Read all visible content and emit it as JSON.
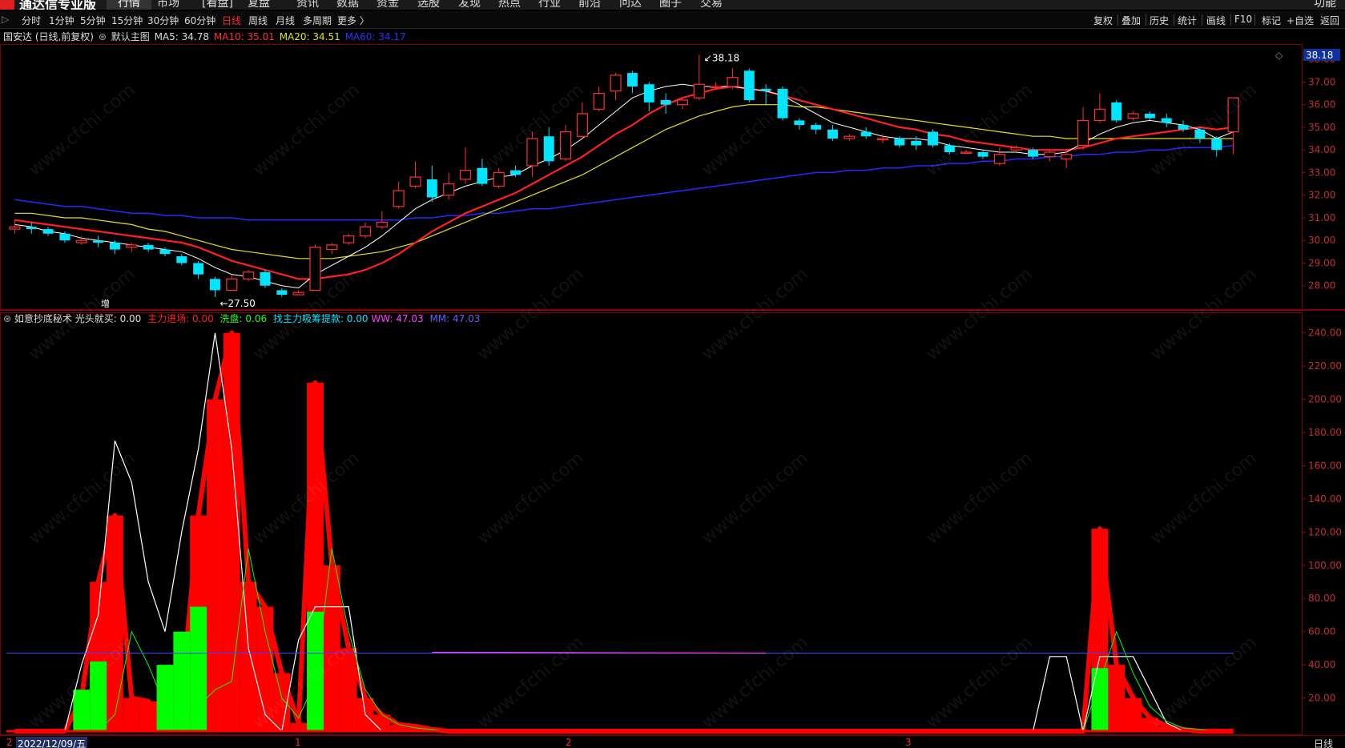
{
  "app": {
    "name": "通达信专业版"
  },
  "menu": [
    "行情",
    "市场",
    "[看盘]",
    "复盘",
    "资讯",
    "数据",
    "资金",
    "选股",
    "发现",
    "热点",
    "行业",
    "前沿",
    "问达",
    "圈子",
    "交易"
  ],
  "menu_right": "功能",
  "periods": [
    "分时",
    "1分钟",
    "5分钟",
    "15分钟",
    "30分钟",
    "60分钟",
    "日线",
    "周线",
    "月线",
    "多周期",
    "更多 〉"
  ],
  "active_period": "日线",
  "tools": [
    "复权",
    "叠加",
    "历史",
    "统计",
    "画线",
    "F10",
    "标记",
    "+自选",
    "返回"
  ],
  "main_info": {
    "stock": "国安达 (日线,前复权)",
    "template": "默认主图",
    "ma5": "MA5: 34.78",
    "ma10": "MA10: 35.01",
    "ma20": "MA20: 34.51",
    "ma60": "MA60: 34.17"
  },
  "price_axis": {
    "labels": [
      "38.00",
      "37.00",
      "36.00",
      "35.00",
      "34.00",
      "33.00",
      "32.00",
      "31.00",
      "30.00",
      "29.00",
      "28.00"
    ],
    "current": "38.18"
  },
  "annotations": {
    "high": "38.18",
    "low": "27.50",
    "marker": "增"
  },
  "ind_info": {
    "name": "如意抄底秘术",
    "gt": "光头就买: 0.00",
    "zl": "主力进场: 0.00",
    "xp": "洗盘: 0.06",
    "zhao": "找主力吸筹提款: 0.00",
    "ww": "WW: 47.03",
    "mm": "MM: 47.03"
  },
  "ind_axis": {
    "labels": [
      "240.00",
      "220.00",
      "200.00",
      "180.00",
      "160.00",
      "140.00",
      "120.00",
      "100.00",
      "80.00",
      "60.00",
      "40.00",
      "20.00"
    ]
  },
  "dates": {
    "first": "2022/12/09/五",
    "m1": "1",
    "m2": "2",
    "m3": "3",
    "period_label": "日线"
  },
  "watermark": "www.cfchi.com",
  "colors": {
    "up": "#ff3030",
    "down": "#00e5ff",
    "ma5": "#ffffff",
    "ma10": "#ff2020",
    "ma20": "#e0e020",
    "ma60": "#2828ff",
    "ind_red": "#ff0000",
    "ind_green": "#00ff00",
    "ww": "#ff40ff",
    "mm": "#4040ff"
  },
  "chart_data": {
    "type": "candlestick",
    "price_range": [
      27.0,
      38.5
    ],
    "candles": [
      [
        30.5,
        30.6,
        30.9,
        30.3
      ],
      [
        30.6,
        30.5,
        30.8,
        30.3
      ],
      [
        30.5,
        30.3,
        30.6,
        30.2
      ],
      [
        30.3,
        30.0,
        30.4,
        29.9
      ],
      [
        29.9,
        30.0,
        30.2,
        29.8
      ],
      [
        30.0,
        29.9,
        30.2,
        29.7
      ],
      [
        29.9,
        29.6,
        30.0,
        29.4
      ],
      [
        29.7,
        29.8,
        29.9,
        29.5
      ],
      [
        29.8,
        29.6,
        29.9,
        29.5
      ],
      [
        29.6,
        29.4,
        29.7,
        29.3
      ],
      [
        29.3,
        29.0,
        29.4,
        28.9
      ],
      [
        29.0,
        28.5,
        29.1,
        28.3
      ],
      [
        28.3,
        27.8,
        28.4,
        27.5
      ],
      [
        27.8,
        28.3,
        28.5,
        27.8
      ],
      [
        28.3,
        28.6,
        28.7,
        28.2
      ],
      [
        28.6,
        28.0,
        28.7,
        27.9
      ],
      [
        27.8,
        27.6,
        27.9,
        27.5
      ],
      [
        27.6,
        27.7,
        27.8,
        27.6
      ],
      [
        27.8,
        29.7,
        29.8,
        27.8
      ],
      [
        29.6,
        29.8,
        29.9,
        29.4
      ],
      [
        29.9,
        30.2,
        30.3,
        29.8
      ],
      [
        30.2,
        30.6,
        30.8,
        30.1
      ],
      [
        30.6,
        30.8,
        31.3,
        30.5
      ],
      [
        31.5,
        32.2,
        32.6,
        31.4
      ],
      [
        32.4,
        32.8,
        33.5,
        32.3
      ],
      [
        32.7,
        31.9,
        33.3,
        31.7
      ],
      [
        32.0,
        32.5,
        33.0,
        31.8
      ],
      [
        32.7,
        33.1,
        34.1,
        32.5
      ],
      [
        33.2,
        32.5,
        33.6,
        32.4
      ],
      [
        32.4,
        33.0,
        33.2,
        32.3
      ],
      [
        33.1,
        32.9,
        33.3,
        32.8
      ],
      [
        33.3,
        34.5,
        34.8,
        32.8
      ],
      [
        34.6,
        33.5,
        35.0,
        33.3
      ],
      [
        33.6,
        34.8,
        35.1,
        33.5
      ],
      [
        34.6,
        35.6,
        36.1,
        34.5
      ],
      [
        35.8,
        36.5,
        36.8,
        35.7
      ],
      [
        36.6,
        37.3,
        37.4,
        36.2
      ],
      [
        37.4,
        36.8,
        37.5,
        36.5
      ],
      [
        36.9,
        36.1,
        37.0,
        35.7
      ],
      [
        36.2,
        36.0,
        36.5,
        35.6
      ],
      [
        36.0,
        36.2,
        36.3,
        35.8
      ],
      [
        36.3,
        36.9,
        38.2,
        36.2
      ],
      [
        36.8,
        36.8,
        37.0,
        36.7
      ],
      [
        36.8,
        37.2,
        37.6,
        36.7
      ],
      [
        37.5,
        36.2,
        37.6,
        36.1
      ],
      [
        36.7,
        36.6,
        36.9,
        36.0
      ],
      [
        36.7,
        35.4,
        36.8,
        35.3
      ],
      [
        35.3,
        35.1,
        35.4,
        34.9
      ],
      [
        35.1,
        34.9,
        35.2,
        34.7
      ],
      [
        34.9,
        34.5,
        35.1,
        34.4
      ],
      [
        34.5,
        34.6,
        34.7,
        34.4
      ],
      [
        34.8,
        34.6,
        35.0,
        34.5
      ],
      [
        34.5,
        34.5,
        34.7,
        34.3
      ],
      [
        34.5,
        34.2,
        34.6,
        34.1
      ],
      [
        34.4,
        34.2,
        34.6,
        34.0
      ],
      [
        34.8,
        34.2,
        34.9,
        34.1
      ],
      [
        34.2,
        33.9,
        34.3,
        33.8
      ],
      [
        33.9,
        33.9,
        34.0,
        33.8
      ],
      [
        33.9,
        33.7,
        34.0,
        33.6
      ],
      [
        33.4,
        33.8,
        34.1,
        33.3
      ],
      [
        34.0,
        34.1,
        34.2,
        33.9
      ],
      [
        34.0,
        33.7,
        34.1,
        33.6
      ],
      [
        33.7,
        33.9,
        34.0,
        33.5
      ],
      [
        33.6,
        33.8,
        34.0,
        33.2
      ],
      [
        34.2,
        35.3,
        35.9,
        34.0
      ],
      [
        35.3,
        35.8,
        36.5,
        35.2
      ],
      [
        36.1,
        35.3,
        36.2,
        35.2
      ],
      [
        35.4,
        35.6,
        35.7,
        35.3
      ],
      [
        35.6,
        35.4,
        35.7,
        35.3
      ],
      [
        35.4,
        35.2,
        35.6,
        35.0
      ],
      [
        35.1,
        34.9,
        35.3,
        34.8
      ],
      [
        34.9,
        34.5,
        35.0,
        34.3
      ],
      [
        34.5,
        34.0,
        34.6,
        33.7
      ],
      [
        34.8,
        36.3,
        36.3,
        33.8
      ]
    ],
    "ma5": [
      30.7,
      30.6,
      30.4,
      30.3,
      30.1,
      30.0,
      29.9,
      29.8,
      29.7,
      29.6,
      29.5,
      29.2,
      28.8,
      28.5,
      28.4,
      28.2,
      28.0,
      27.9,
      28.5,
      28.9,
      29.3,
      29.7,
      30.2,
      30.8,
      31.4,
      31.8,
      32.1,
      32.4,
      32.6,
      32.8,
      32.9,
      33.3,
      33.6,
      34.0,
      34.5,
      35.1,
      35.7,
      36.3,
      36.6,
      36.8,
      36.9,
      36.8,
      36.8,
      36.8,
      36.7,
      36.6,
      36.4,
      36.0,
      35.6,
      35.2,
      35.0,
      34.8,
      34.6,
      34.5,
      34.5,
      34.4,
      34.2,
      34.1,
      34.0,
      33.9,
      33.9,
      33.8,
      33.8,
      33.9,
      34.3,
      34.7,
      35.0,
      35.2,
      35.3,
      35.2,
      35.1,
      34.9,
      34.5,
      34.8
    ],
    "ma10": [
      30.9,
      30.8,
      30.7,
      30.6,
      30.5,
      30.4,
      30.3,
      30.2,
      30.1,
      30.0,
      29.9,
      29.7,
      29.4,
      29.1,
      28.9,
      28.7,
      28.5,
      28.3,
      28.3,
      28.4,
      28.5,
      28.7,
      29.0,
      29.4,
      29.9,
      30.4,
      30.8,
      31.2,
      31.5,
      31.8,
      32.1,
      32.5,
      32.9,
      33.3,
      33.7,
      34.2,
      34.7,
      35.1,
      35.6,
      36.0,
      36.3,
      36.5,
      36.7,
      36.8,
      36.7,
      36.6,
      36.4,
      36.2,
      36.0,
      35.8,
      35.6,
      35.4,
      35.2,
      35.0,
      34.9,
      34.7,
      34.6,
      34.4,
      34.3,
      34.2,
      34.1,
      34.0,
      34.0,
      34.0,
      34.1,
      34.3,
      34.5,
      34.6,
      34.7,
      34.8,
      34.9,
      35.0,
      34.9,
      35.0
    ],
    "ma20": [
      31.2,
      31.2,
      31.1,
      31.0,
      31.0,
      30.9,
      30.8,
      30.7,
      30.5,
      30.4,
      30.2,
      30.0,
      29.8,
      29.6,
      29.5,
      29.4,
      29.3,
      29.2,
      29.2,
      29.2,
      29.3,
      29.4,
      29.5,
      29.7,
      29.9,
      30.2,
      30.5,
      30.8,
      31.1,
      31.4,
      31.7,
      32.0,
      32.3,
      32.6,
      32.9,
      33.3,
      33.7,
      34.1,
      34.5,
      34.9,
      35.2,
      35.5,
      35.7,
      35.9,
      36.0,
      36.0,
      36.0,
      35.9,
      35.9,
      35.8,
      35.7,
      35.6,
      35.5,
      35.4,
      35.3,
      35.2,
      35.1,
      35.0,
      34.9,
      34.8,
      34.7,
      34.6,
      34.6,
      34.5,
      34.5,
      34.5,
      34.5,
      34.5,
      34.5,
      34.5,
      34.5,
      34.5,
      34.5,
      34.5
    ],
    "ma60": [
      31.8,
      31.7,
      31.6,
      31.5,
      31.5,
      31.4,
      31.3,
      31.2,
      31.2,
      31.1,
      31.1,
      31.0,
      31.0,
      31.0,
      30.9,
      30.9,
      30.9,
      30.9,
      30.9,
      30.9,
      30.9,
      30.9,
      30.9,
      30.9,
      31.0,
      31.0,
      31.1,
      31.1,
      31.2,
      31.2,
      31.3,
      31.4,
      31.4,
      31.5,
      31.6,
      31.7,
      31.8,
      31.9,
      32.0,
      32.1,
      32.2,
      32.3,
      32.4,
      32.5,
      32.6,
      32.7,
      32.8,
      32.9,
      33.0,
      33.0,
      33.1,
      33.1,
      33.2,
      33.2,
      33.3,
      33.3,
      33.4,
      33.4,
      33.5,
      33.5,
      33.6,
      33.6,
      33.7,
      33.7,
      33.8,
      33.8,
      33.9,
      33.9,
      34.0,
      34.0,
      34.1,
      34.1,
      34.1,
      34.2
    ],
    "ind_range": [
      0,
      250
    ],
    "ind_red": [
      0,
      0,
      0,
      0,
      20,
      90,
      130,
      20,
      18,
      8,
      20,
      130,
      200,
      240,
      90,
      75,
      35,
      5,
      210,
      100,
      50,
      20,
      10,
      4,
      3,
      1,
      0,
      0,
      0,
      0,
      0,
      0,
      0,
      0,
      0,
      0,
      0,
      0,
      0,
      0,
      0,
      0,
      0,
      0,
      0,
      0,
      0,
      0,
      0,
      0,
      0,
      0,
      0,
      0,
      0,
      0,
      0,
      0,
      0,
      0,
      0,
      0,
      0,
      0,
      0,
      122,
      40,
      20,
      8,
      3,
      1,
      0,
      0,
      0
    ],
    "ind_green": [
      0,
      0,
      0,
      0,
      25,
      42,
      0,
      0,
      0,
      40,
      60,
      75,
      0,
      0,
      0,
      0,
      0,
      0,
      72,
      0,
      0,
      0,
      0,
      0,
      0,
      0,
      0,
      0,
      0,
      0,
      0,
      0,
      0,
      0,
      0,
      0,
      0,
      0,
      0,
      0,
      0,
      0,
      0,
      0,
      0,
      0,
      0,
      0,
      0,
      0,
      0,
      0,
      0,
      0,
      0,
      0,
      0,
      0,
      0,
      0,
      0,
      0,
      0,
      0,
      0,
      38,
      0,
      0,
      0,
      0,
      0,
      0,
      0,
      0
    ],
    "ind_white": [
      0,
      0,
      0,
      0,
      40,
      70,
      175,
      150,
      90,
      60,
      120,
      170,
      240,
      170,
      50,
      10,
      0,
      55,
      75,
      75,
      75,
      10,
      0,
      0,
      0,
      0,
      0,
      0,
      0,
      0,
      0,
      0,
      0,
      0,
      0,
      0,
      0,
      0,
      0,
      0,
      0,
      0,
      0,
      0,
      0,
      0,
      0,
      0,
      0,
      0,
      0,
      0,
      0,
      0,
      0,
      0,
      0,
      0,
      0,
      0,
      0,
      0,
      45,
      45,
      0,
      45,
      45,
      45,
      25,
      5,
      0,
      0,
      0,
      0
    ],
    "ind_thin_green": [
      0,
      0,
      0,
      0,
      0,
      0,
      10,
      60,
      40,
      15,
      5,
      15,
      25,
      30,
      110,
      60,
      20,
      8,
      30,
      110,
      60,
      25,
      10,
      4,
      2,
      1,
      0,
      0,
      0,
      0,
      0,
      0,
      0,
      0,
      0,
      0,
      0,
      0,
      0,
      0,
      0,
      0,
      0,
      0,
      0,
      0,
      0,
      0,
      0,
      0,
      0,
      0,
      0,
      0,
      0,
      0,
      0,
      0,
      0,
      0,
      0,
      0,
      0,
      0,
      0,
      30,
      60,
      35,
      15,
      6,
      2,
      1,
      0,
      0
    ],
    "ww_level": 47.03
  }
}
